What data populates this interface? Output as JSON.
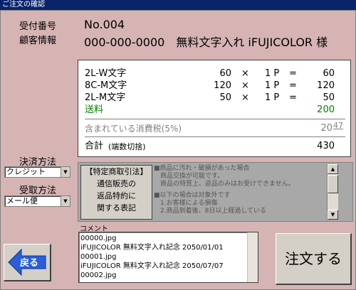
{
  "window": {
    "title": "ご注文の確認"
  },
  "left": {
    "receipt_label": "受付番号",
    "customer_label": "顧客情報",
    "payment_label": "決済方法",
    "payment_value": "クレジット",
    "delivery_label": "受取方法",
    "delivery_value": "メール便",
    "back_label": "戻る"
  },
  "header": {
    "order_no": "No.004",
    "customer_line": "000-000-0000　無料文字入れ iFUJICOLOR 様"
  },
  "receipt": {
    "items": [
      {
        "name": "2L-W文字",
        "unit": "60",
        "times": "×",
        "qty": "1 P",
        "eq": "=",
        "total": "60"
      },
      {
        "name": "8C-M文字",
        "unit": "120",
        "times": "×",
        "qty": "1 P",
        "eq": "=",
        "total": "120"
      },
      {
        "name": "2L-M文字",
        "unit": "50",
        "times": "×",
        "qty": "1 P",
        "eq": "=",
        "total": "50"
      }
    ],
    "shipping_label": "送料",
    "shipping_value": "200",
    "tax_label": "含まれている消費税(5%)",
    "tax_value": "20",
    "tax_decimal": "47",
    "total_label": "合計",
    "total_note": "(端数切捨)",
    "total_value": "430"
  },
  "legal": {
    "title_line1": "【特定商取引法】",
    "title_line2": "通信販売の",
    "title_line3": "返品特約に",
    "title_line4": "関する表記",
    "text_lines": [
      "■商品に汚れ・破損があった場合",
      "　商品交換が可能です。",
      "　商品の特質上、返品のみはお受けできません。",
      "",
      "■以下の場合は対象外です",
      "　1.お客様による損傷",
      "　2.商品到着後、8日以上経過している"
    ]
  },
  "comment": {
    "label": "コメント",
    "lines": [
      "00000.jpg",
      "iFUJICOLOR 無料文字入れ記念 2050/01/01",
      "00001.jpg",
      "iFUJICOLOR 無料文字入れ記念 2050/07/07",
      "00002.jpg"
    ]
  },
  "order_button": "注文する",
  "colors": {
    "pink_bg": "#d6b4b4",
    "title_bar": "#0a246a",
    "shipping_green": "#008000"
  }
}
